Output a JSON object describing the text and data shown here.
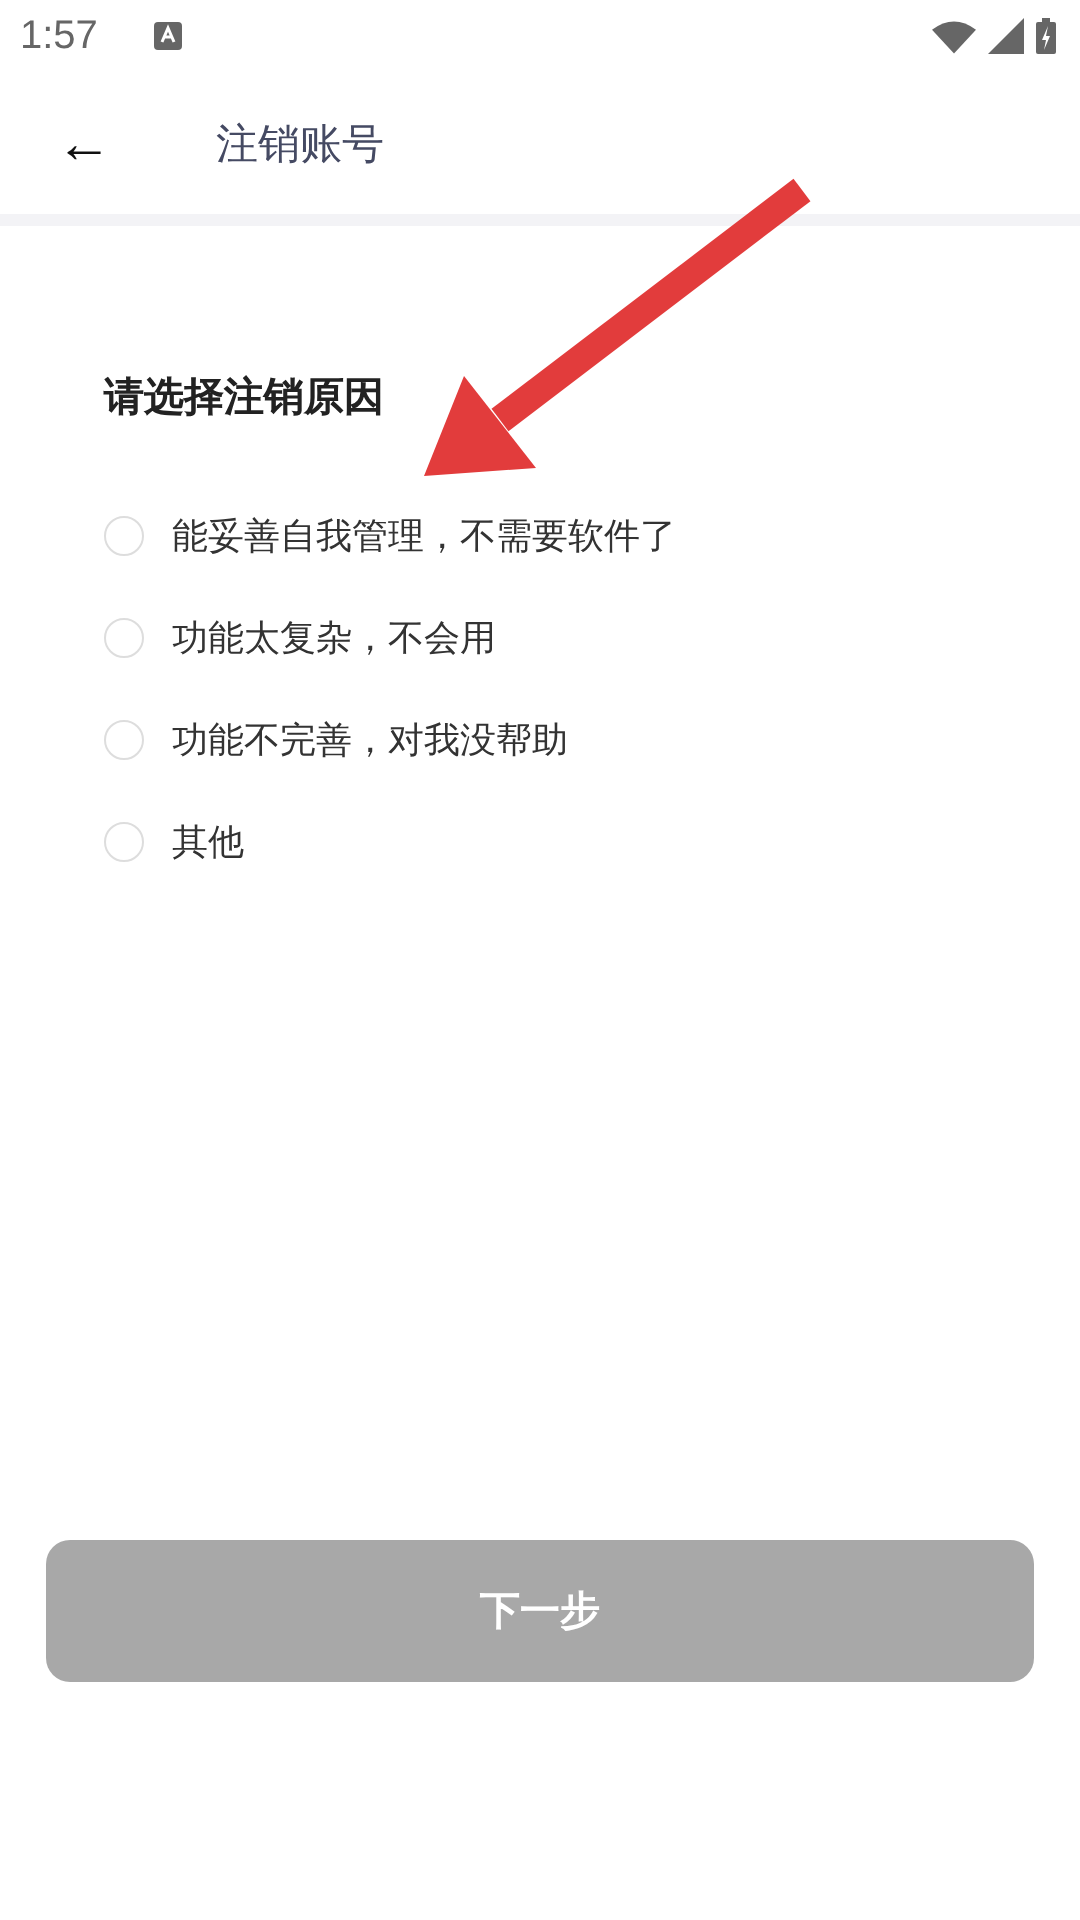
{
  "status_bar": {
    "time": "1:57"
  },
  "header": {
    "back_icon": "←",
    "title": "注销账号"
  },
  "section": {
    "heading": "请选择注销原因"
  },
  "options": [
    {
      "label": "能妥善自我管理，不需要软件了",
      "selected": false
    },
    {
      "label": "功能太复杂，不会用",
      "selected": false
    },
    {
      "label": "功能不完善，对我没帮助",
      "selected": false
    },
    {
      "label": "其他",
      "selected": false
    }
  ],
  "next_button": {
    "label": "下一步",
    "disabled": true
  },
  "annotation": {
    "kind": "arrow"
  }
}
